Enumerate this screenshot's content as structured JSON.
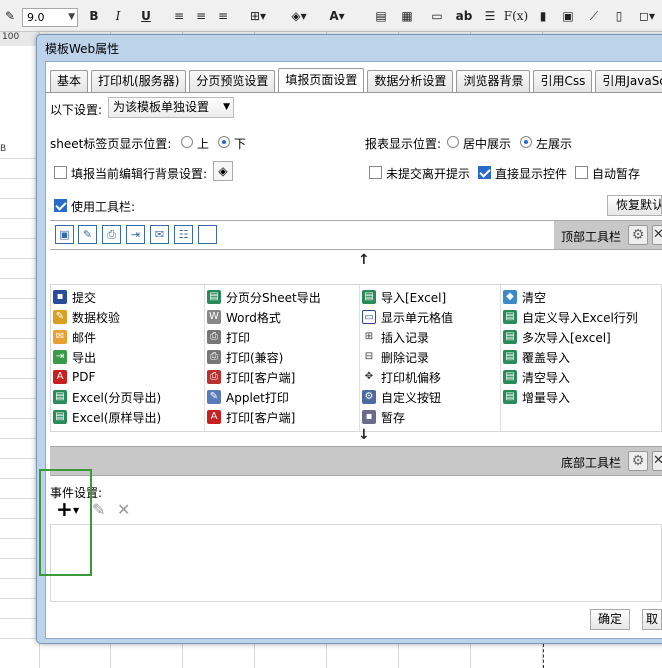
{
  "app": {
    "zoom_value": "9.0",
    "col_header": "100",
    "row_b": "B"
  },
  "dialog": {
    "title": "模板Web属性",
    "tabs": [
      "基本",
      "打印机(服务器)",
      "分页预览设置",
      "填报页面设置",
      "数据分析设置",
      "浏览器背景",
      "引用Css",
      "引用JavaScript"
    ],
    "active_tab": "填报页面设置"
  },
  "form": {
    "setting_label": "以下设置:",
    "setting_value": "为该模板单独设置",
    "sheet_pos_label": "sheet标签页显示位置:",
    "sheet_pos_top": "上",
    "sheet_pos_bottom": "下",
    "report_pos_label": "报表显示位置:",
    "report_pos_center": "居中展示",
    "report_pos_left": "左展示",
    "bg_label": "填报当前编辑行背景设置:",
    "unsaved_label": "未提交离开提示",
    "direct_show_label": "直接显示控件",
    "auto_save_label": "自动暂存",
    "use_toolbar_label": "使用工具栏:",
    "restore_label": "恢复默认"
  },
  "toolbars": {
    "top_label": "顶部工具栏",
    "bottom_label": "底部工具栏"
  },
  "items": {
    "col1": [
      "提交",
      "数据校验",
      "邮件",
      "导出",
      "PDF",
      "Excel(分页导出)",
      "Excel(原样导出)"
    ],
    "col2": [
      "分页分Sheet导出",
      "Word格式",
      "打印",
      "打印(兼容)",
      "打印[客户端]",
      "Applet打印",
      "打印[客户端]"
    ],
    "col3": [
      "导入[Excel]",
      "显示单元格值",
      "插入记录",
      "删除记录",
      "打印机偏移",
      "自定义按钮",
      "暂存"
    ],
    "col4": [
      "清空",
      "自定义导入Excel行列",
      "多次导入[excel]",
      "覆盖导入",
      "清空导入",
      "增量导入"
    ]
  },
  "events": {
    "label": "事件设置:",
    "add": "+",
    "edit": "✎",
    "delete": "✕"
  },
  "buttons": {
    "ok": "确定",
    "cancel": "取消"
  },
  "colors": {
    "accent": "#2a6ac8",
    "dialog_frame": "#bdd3ea",
    "highlight": "#3a9a3a"
  }
}
